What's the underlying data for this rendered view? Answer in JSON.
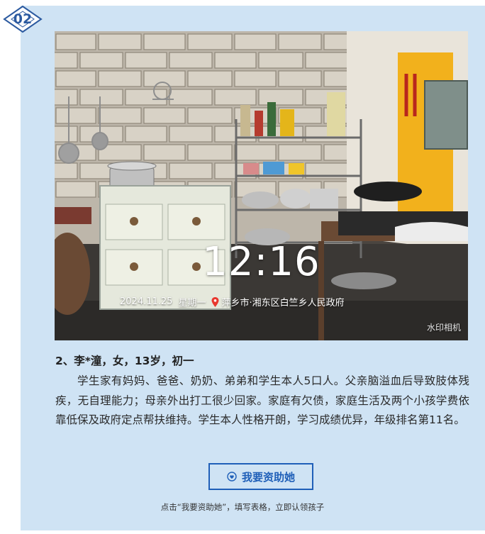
{
  "badge": {
    "number": "02",
    "color": "#2c5aa0"
  },
  "photo": {
    "time": "12:16",
    "date": "2024.11.25",
    "weekday": "星期一",
    "location": "萍乡市·湘东区白竺乡人民政府",
    "watermark": "水印相机"
  },
  "student": {
    "title": "2、李*潼，女，13岁，初一",
    "description": "学生家有妈妈、爸爸、奶奶、弟弟和学生本人5口人。父亲脑溢血后导致肢体残疾，无自理能力；母亲外出打工很少回家。家庭有欠债，家庭生活及两个小孩学费依靠低保及政府定点帮扶维持。学生本人性格开朗，学习成绩优异，年级排名第11名。"
  },
  "cta": {
    "label": "我要资助她",
    "icon": "heart-hand-icon",
    "color": "#1f5fb8"
  },
  "footer": {
    "note": "点击“我要资助她”，填写表格，立即认领孩子"
  },
  "colors": {
    "card_background": "#cfe3f4",
    "accent": "#1f5fb8"
  }
}
